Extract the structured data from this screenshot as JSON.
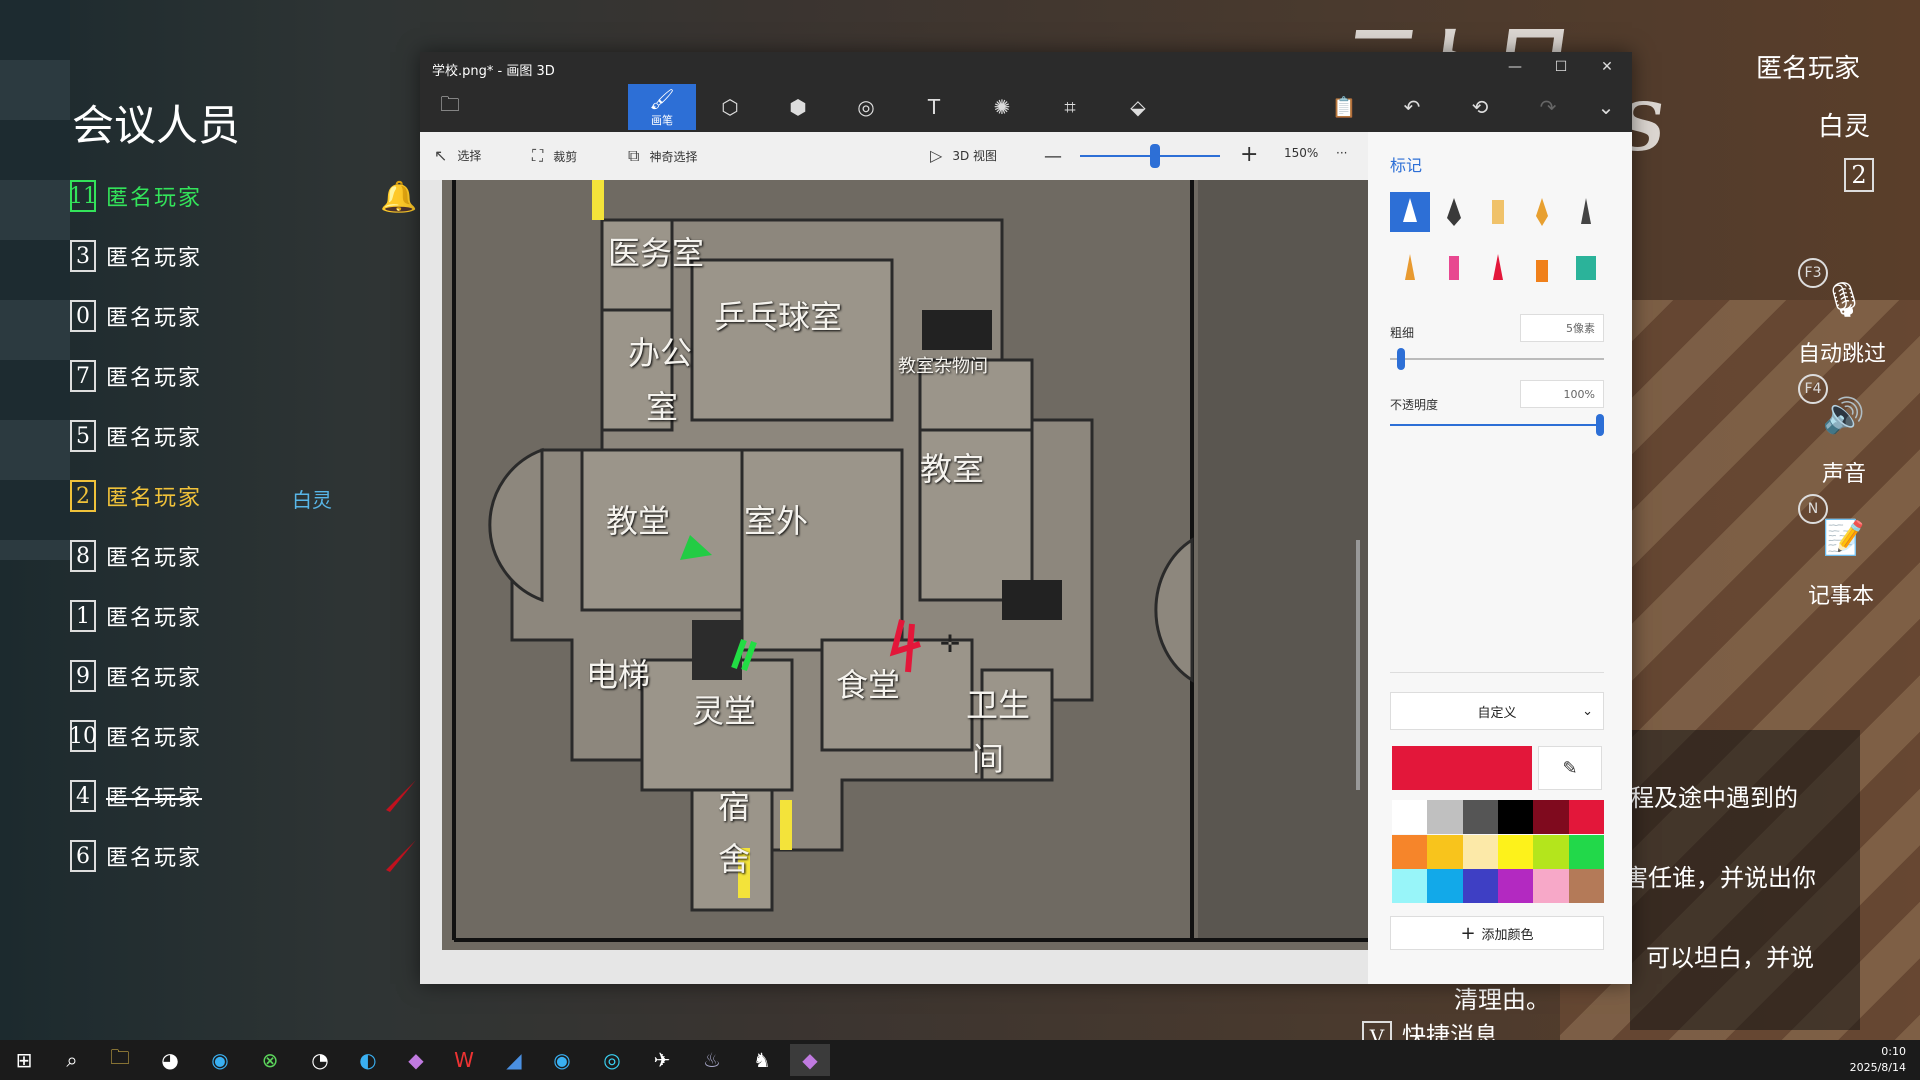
{
  "game": {
    "meeting_title": "会议人员",
    "players": [
      {
        "num": "11",
        "name": "匿名玩家",
        "style": "green"
      },
      {
        "num": "3",
        "name": "匿名玩家",
        "style": ""
      },
      {
        "num": "0",
        "name": "匿名玩家",
        "style": ""
      },
      {
        "num": "7",
        "name": "匿名玩家",
        "style": ""
      },
      {
        "num": "5",
        "name": "匿名玩家",
        "style": ""
      },
      {
        "num": "2",
        "name": "匿名玩家",
        "style": "yellow"
      },
      {
        "num": "8",
        "name": "匿名玩家",
        "style": ""
      },
      {
        "num": "1",
        "name": "匿名玩家",
        "style": ""
      },
      {
        "num": "9",
        "name": "匿名玩家",
        "style": ""
      },
      {
        "num": "10",
        "name": "匿名玩家",
        "style": ""
      },
      {
        "num": "4",
        "name": "匿名玩家",
        "style": "struck"
      },
      {
        "num": "6",
        "name": "匿名玩家",
        "style": ""
      }
    ],
    "ghost_tag": "白灵",
    "top_right_name": "匿名玩家",
    "top_right_role": "白灵",
    "top_right_num": "2",
    "hud": {
      "f3_key": "F3",
      "auto_skip": "自动跳过",
      "f4_key": "F4",
      "sound": "声音",
      "n_key": "N",
      "notepad": "记事本"
    },
    "chat_lines": [
      "程及途中遇到的",
      "害任谁，并说出你",
      "可以坦白，并说",
      "清理由。"
    ],
    "quick_msg_key": "V",
    "quick_msg": "快捷消息"
  },
  "paint3d": {
    "window_title": "学校.png* - 画图 3D",
    "tools": [
      {
        "name": "brushes",
        "label": "画笔",
        "icon": "🖌"
      },
      {
        "name": "2d-shapes",
        "label": "",
        "icon": "⬡"
      },
      {
        "name": "3d-shapes",
        "label": "",
        "icon": "⬢"
      },
      {
        "name": "stickers",
        "label": "",
        "icon": "◎"
      },
      {
        "name": "text",
        "label": "",
        "icon": "T"
      },
      {
        "name": "effects",
        "label": "",
        "icon": "✺"
      },
      {
        "name": "canvas",
        "label": "",
        "icon": "⌗"
      },
      {
        "name": "3d-library",
        "label": "",
        "icon": "⬙"
      }
    ],
    "subbar": {
      "select": "选择",
      "crop": "裁剪",
      "magic_select": "神奇选择",
      "view_3d": "3D 视图",
      "zoom": "150%",
      "more": "···"
    },
    "map_labels": {
      "infirmary": "医务室",
      "office": "办公",
      "office2": "室",
      "pingpong": "乒乓球室",
      "storage": "教室杂物间",
      "classroom_left": "教堂",
      "outdoor": "室外",
      "classroom_right": "教室",
      "elevator": "电梯",
      "spirit_hall": "灵堂",
      "canteen": "食堂",
      "toilet": "卫生",
      "toilet2": "间",
      "dorm": "宿",
      "dorm2": "舍"
    },
    "panel": {
      "title": "标记",
      "thickness_label": "粗细",
      "thickness_value": "5像素",
      "thickness_level": 0.05,
      "opacity_label": "不透明度",
      "opacity_value": "100%",
      "opacity_level": 1.0,
      "color_mode": "自定义",
      "add_color": "添加颜色",
      "current_color": "#e3173a",
      "palette": [
        "#ffffff",
        "#c0c0c0",
        "#555555",
        "#000000",
        "#7f0a1e",
        "#e3173a",
        "#f6852a",
        "#f8c41c",
        "#fce9a8",
        "#fdf21b",
        "#b4e51c",
        "#22d84a",
        "#98f5f9",
        "#12a9e9",
        "#3e3fc4",
        "#b329c1",
        "#f7a8c8",
        "#b47a58"
      ]
    }
  },
  "taskbar": {
    "time": "0:10",
    "date": "2025/8/14"
  }
}
